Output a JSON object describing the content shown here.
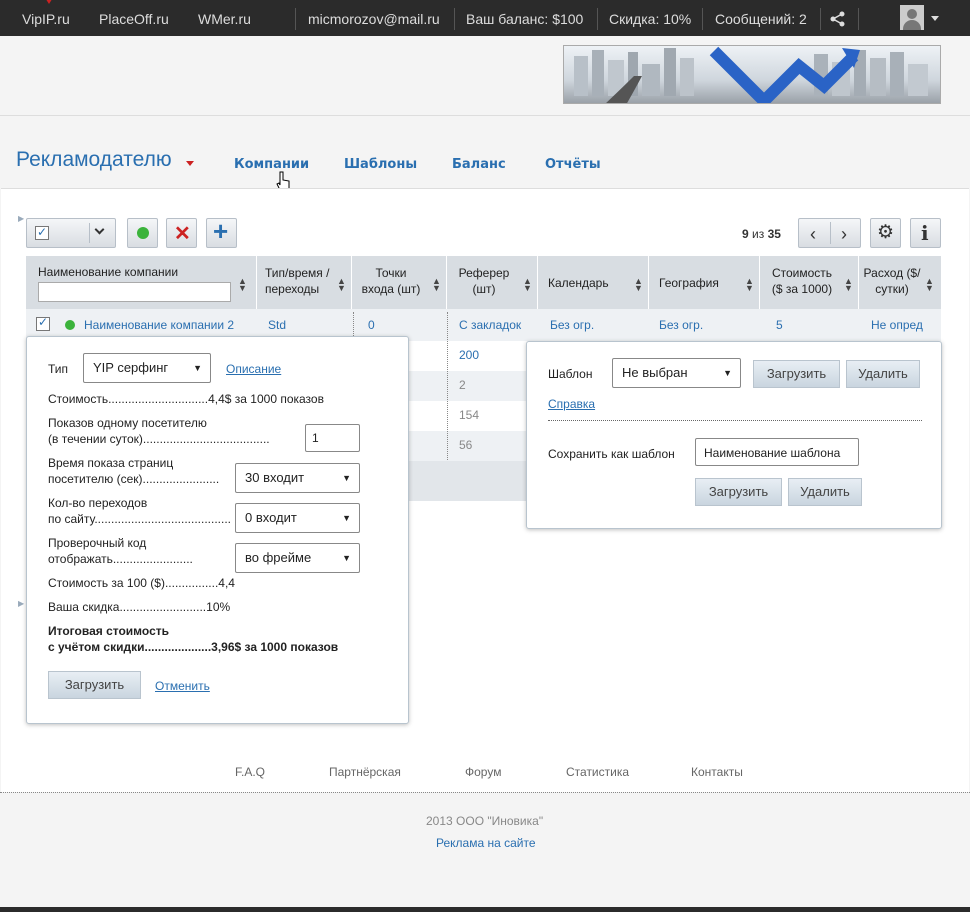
{
  "topbar": {
    "site1": "VipIP.ru",
    "site2": "PlaceOff.ru",
    "site3": "WMer.ru",
    "email": "micmorozov@mail.ru",
    "balance": "Ваш баланс: $100",
    "discount": "Скидка: 10%",
    "messages": "Сообщений: 2"
  },
  "section": {
    "title": "Рекламодателю"
  },
  "nav": {
    "items": [
      "Компании",
      "Шаблоны",
      "Баланс",
      "Отчёты"
    ]
  },
  "pager": {
    "current": "9",
    "sep": "из",
    "total": "35"
  },
  "table": {
    "headers": [
      "Наименование компании",
      "Тип/время /переходы",
      "Точки входа (шт)",
      "Реферер (шт)",
      "Календарь",
      "География",
      "Стоимость ($ за 1000)",
      "Расход ($/сутки)"
    ],
    "row": {
      "name": "Наименование компании 2",
      "type": "Std",
      "points": "0",
      "referer": "С закладок",
      "calendar": "Без огр.",
      "geo": "Без огр.",
      "cost": "5",
      "spend": "Не опред"
    },
    "extra_referer": [
      "200",
      "2",
      "154",
      "56"
    ]
  },
  "left_panel": {
    "type_label": "Тип",
    "type_value": "YIP серфинг",
    "description_link": "Описание",
    "cost_line": "Стоимость..............................4,4$ за 1000 показов",
    "views_line1": "Показов одному посетителю",
    "views_line2": "(в течении суток)......................................",
    "views_value": "1",
    "time_line1": "Время показа страниц",
    "time_line2": "посетителю (сек).......................",
    "time_value": "30 входит",
    "clicks_line1": "Кол-во переходов",
    "clicks_line2": "по сайту...........................................",
    "clicks_value": "0 входит",
    "code_line1": "Проверочный код",
    "code_line2": "отображать........................",
    "code_value": "во фрейме",
    "cost100_line": "Стоимость за 100 ($)................4,4",
    "disc_line": "Ваша скидка..........................10%",
    "total_line1": "Итоговая стоимость",
    "total_line2": "с учётом скидки....................3,96$ за 1000 показов",
    "load_btn": "Загрузить",
    "cancel_link": "Отменить"
  },
  "right_panel": {
    "template_label": "Шаблон",
    "template_value": "Не выбран",
    "load_btn": "Загрузить",
    "delete_btn": "Удалить",
    "help_link": "Справка",
    "save_label": "Сохранить как шаблон",
    "save_value": "Наименование шаблона",
    "load_btn2": "Загрузить",
    "delete_btn2": "Удалить"
  },
  "footer": {
    "links": [
      "F.A.Q",
      "Партнёрская",
      "Форум",
      "Статистика",
      "Контакты"
    ],
    "copyright": "2013 ООО \"Иновика\"",
    "ads": "Реклама на сайте"
  },
  "colors": {
    "link": "#2a6fb0",
    "topbar": "#2b2b2b",
    "header_row": "#d8dde2",
    "accent_red": "#cc2222",
    "status_green": "#3bb33b"
  }
}
